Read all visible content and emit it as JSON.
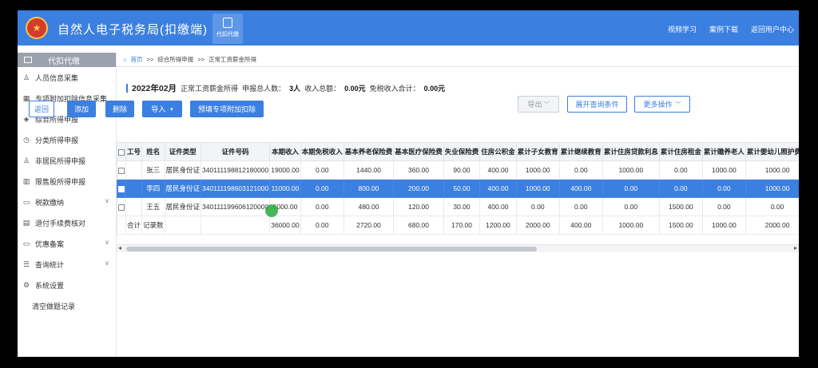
{
  "header": {
    "app_title": "自然人电子税务局(扣缴端)",
    "module_tab": "代扣代缴",
    "links": [
      "视频学习",
      "案例下载",
      "返回用户中心"
    ]
  },
  "sidebar": {
    "head": "代扣代缴",
    "items": [
      {
        "label": "人员信息采集",
        "icon": "person-icon",
        "chevron": false
      },
      {
        "label": "专项附加扣除信息采集",
        "icon": "grid-icon",
        "chevron": false
      },
      {
        "label": "综合所得申报",
        "icon": "layers-icon",
        "chevron": false
      },
      {
        "label": "分类所得申报",
        "icon": "clock-icon",
        "chevron": false
      },
      {
        "label": "非居民所得申报",
        "icon": "person-icon",
        "chevron": false
      },
      {
        "label": "限售股所得申报",
        "icon": "bar-chart-icon",
        "chevron": false
      },
      {
        "label": "税款缴纳",
        "icon": "folder-icon",
        "chevron": true
      },
      {
        "label": "退付手续费核对",
        "icon": "doc-icon",
        "chevron": false
      },
      {
        "label": "优惠备案",
        "icon": "folder-icon",
        "chevron": true
      },
      {
        "label": "查询统计",
        "icon": "list-icon",
        "chevron": true
      },
      {
        "label": "系统设置",
        "icon": "gear-icon",
        "chevron": false
      },
      {
        "label": "清空做题记录",
        "icon": "",
        "chevron": false
      }
    ]
  },
  "breadcrumb": {
    "home": "首页",
    "sep": ">>",
    "level1": "综合所得申报",
    "level2": "正常工资薪金所得"
  },
  "summary": {
    "period": "2022年02月",
    "type": "正常工资薪金所得",
    "count_label": "申报总人数：",
    "count_value": "3人",
    "income_label": "收入总额：",
    "income_value": "0.00元",
    "exempt_label": "免税收入合计：",
    "exempt_value": "0.00元"
  },
  "toolbar": {
    "back": "返回",
    "add": "添加",
    "delete": "删除",
    "import": "导入",
    "prefill": "预填专项附加扣除",
    "export": "导出",
    "expand_query": "展开查询条件",
    "more_ops": "更多操作"
  },
  "table": {
    "headers": [
      "工号",
      "姓名",
      "证件类型",
      "证件号码",
      "本期收入",
      "本期免税收入",
      "基本养老保险费",
      "基本医疗保险费",
      "失业保险费",
      "住房公积金",
      "累计子女教育",
      "累计继续教育",
      "累计住房贷款利息",
      "累计住房租金",
      "累计赡养老人",
      "累计婴幼儿照护费用"
    ],
    "rows": [
      {
        "selected": false,
        "cells": [
          "",
          "张三",
          "居民身份证",
          "340111198812180000",
          "19000.00",
          "0.00",
          "1440.00",
          "360.00",
          "90.00",
          "400.00",
          "1000.00",
          "0.00",
          "1000.00",
          "0.00",
          "1000.00",
          "1000.00"
        ]
      },
      {
        "selected": true,
        "cells": [
          "",
          "李四",
          "居民身份证",
          "340111198603121000",
          "11000.00",
          "0.00",
          "800.00",
          "200.00",
          "50.00",
          "400.00",
          "1000.00",
          "400.00",
          "0.00",
          "0.00",
          "0.00",
          "1000.00"
        ]
      },
      {
        "selected": false,
        "cells": [
          "",
          "王五",
          "居民身份证",
          "340111199606120000",
          "6000.00",
          "0.00",
          "480.00",
          "120.00",
          "30.00",
          "400.00",
          "0.00",
          "0.00",
          "0.00",
          "1500.00",
          "0.00",
          "0.00"
        ]
      }
    ],
    "total_row": [
      "合计",
      "记录数",
      "",
      "",
      "36000.00",
      "0.00",
      "2720.00",
      "680.00",
      "170.00",
      "1200.00",
      "2000.00",
      "400.00",
      "1000.00",
      "1500.00",
      "1000.00",
      "2000.00"
    ]
  },
  "colors": {
    "brand": "#3b7fe0",
    "sidebar_head": "#9aa2ad",
    "selected_row": "#3b7fe0"
  }
}
